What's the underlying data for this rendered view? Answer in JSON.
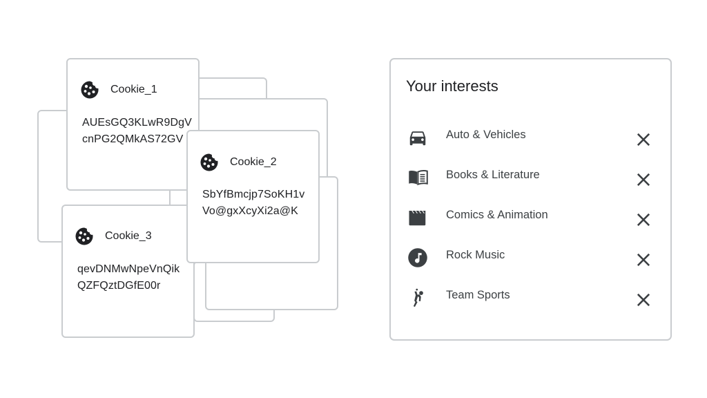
{
  "cookies": [
    {
      "name": "Cookie_1",
      "value_line1": "AUEsGQ3KLwR9DgV",
      "value_line2": "cnPG2QMkAS72GV",
      "icon": "cookie-icon"
    },
    {
      "name": "Cookie_2",
      "value_line1": "SbYfBmcjp7SoKH1v",
      "value_line2": "Vo@gxXcyXi2a@K",
      "icon": "cookie-icon"
    },
    {
      "name": "Cookie_3",
      "value_line1": "qevDNMwNpeVnQik",
      "value_line2": "QZFQztDGfE00r",
      "icon": "cookie-icon"
    }
  ],
  "interests_panel": {
    "title": "Your interests",
    "items": [
      {
        "label": "Auto & Vehicles",
        "icon": "car-icon",
        "action_icon": "close-icon"
      },
      {
        "label": "Books & Literature",
        "icon": "book-icon",
        "action_icon": "close-icon"
      },
      {
        "label": "Comics & Animation",
        "icon": "clapperboard-icon",
        "action_icon": "close-icon"
      },
      {
        "label": "Rock Music",
        "icon": "music-note-icon",
        "action_icon": "close-icon"
      },
      {
        "label": "Team Sports",
        "icon": "sports-player-icon",
        "action_icon": "close-icon"
      }
    ]
  },
  "colors": {
    "border": "#c9cccf",
    "icon": "#3c4043",
    "text": "#202124"
  }
}
